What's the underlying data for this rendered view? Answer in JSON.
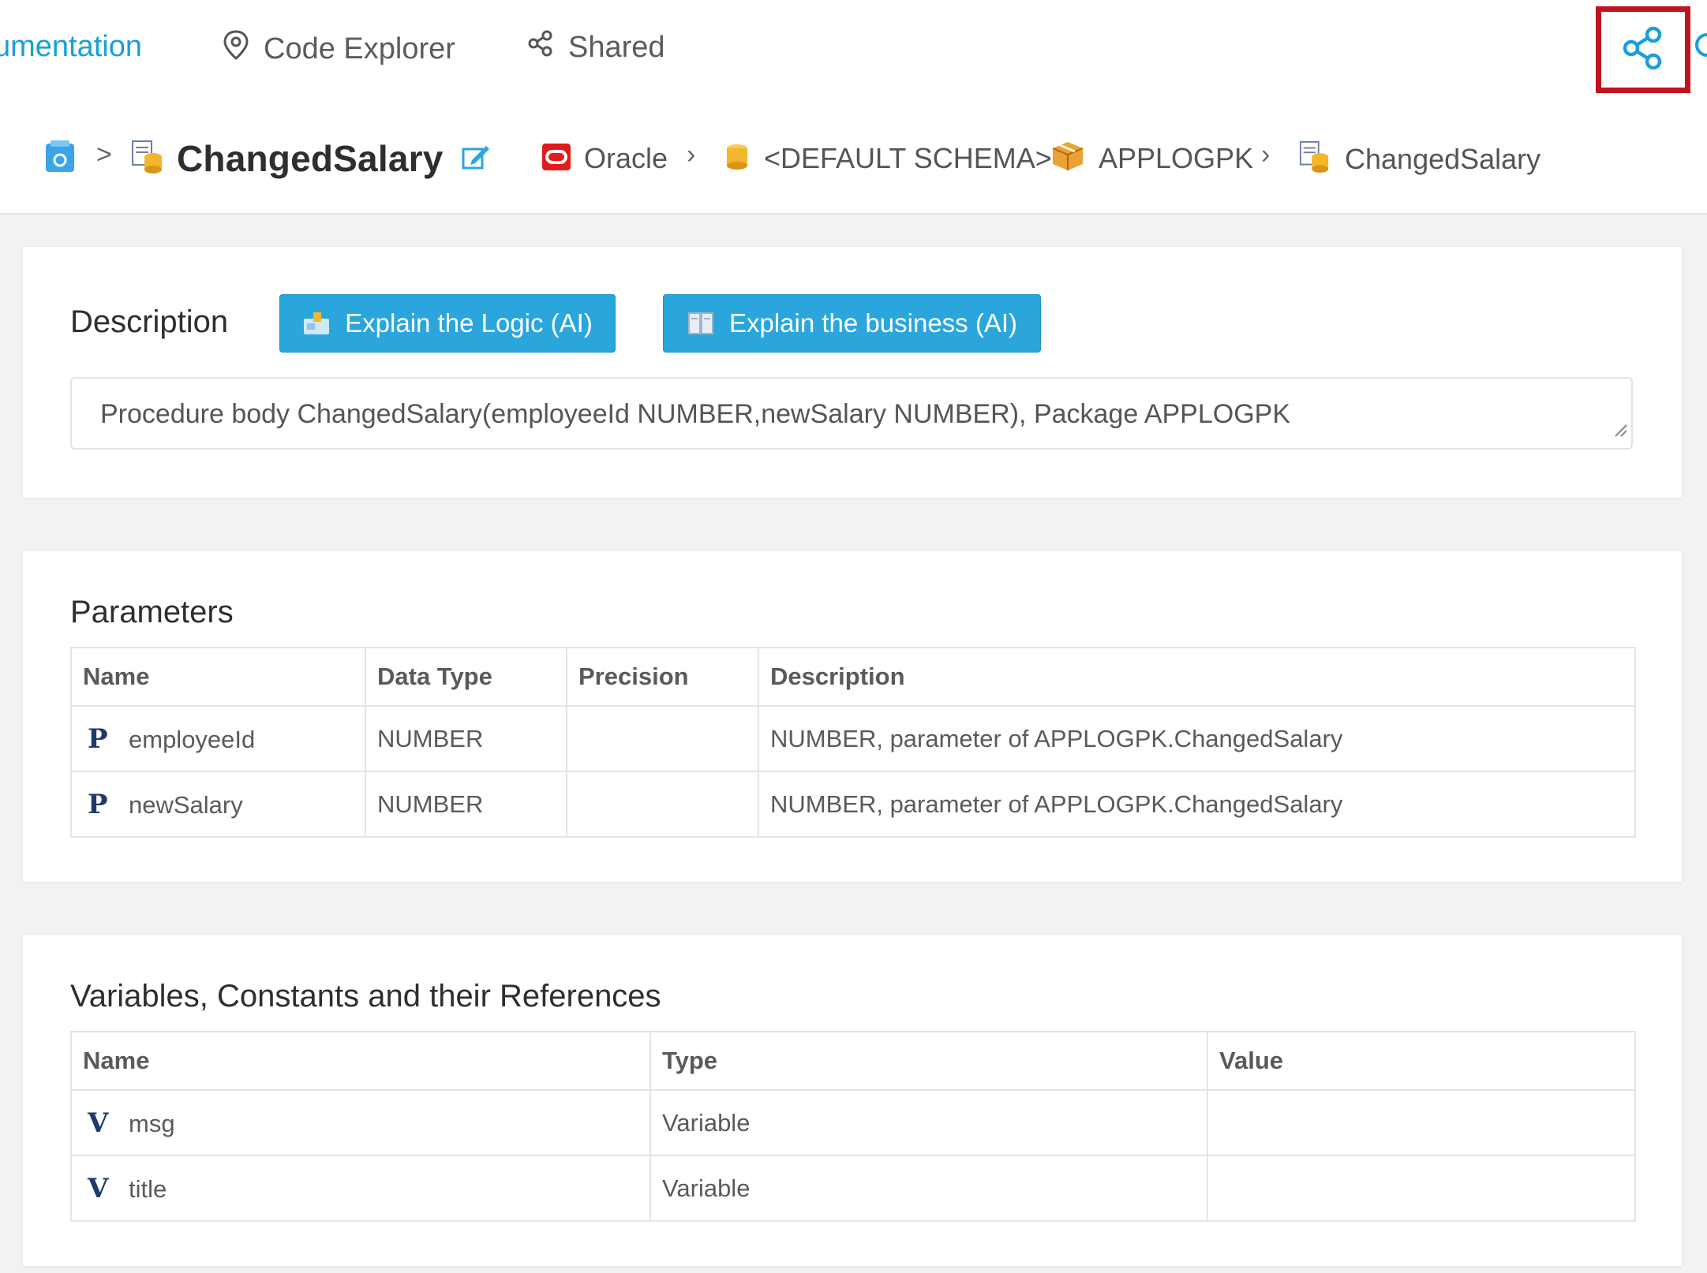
{
  "nav": {
    "items": [
      {
        "label": "umentation"
      },
      {
        "label": "Code Explorer",
        "icon": "map-marker-icon"
      },
      {
        "label": "Shared",
        "icon": "share-icon"
      }
    ],
    "share_button_icon": "share-icon",
    "accent_color": "#1a9fd9",
    "highlight_color": "#c1121f"
  },
  "header": {
    "home_icon": "home-icon",
    "title": "ChangedSalary",
    "title_icon": "procedure-icon",
    "edit_icon": "edit-icon",
    "path": [
      {
        "label": "Oracle",
        "icon": "oracle-icon"
      },
      {
        "label": "<DEFAULT SCHEMA>",
        "icon": "database-icon"
      },
      {
        "label": "APPLOGPK",
        "icon": "package-icon"
      },
      {
        "label": "ChangedSalary",
        "icon": "procedure-icon"
      }
    ]
  },
  "description": {
    "label": "Description",
    "buttons": [
      {
        "label": "Explain the Logic (AI)",
        "icon": "logic-icon"
      },
      {
        "label": "Explain the business (AI)",
        "icon": "book-icon"
      }
    ],
    "text": "Procedure body ChangedSalary(employeeId NUMBER,newSalary NUMBER), Package APPLOGPK",
    "button_color": "#2ba6dc"
  },
  "parameters": {
    "title": "Parameters",
    "columns": [
      "Name",
      "Data Type",
      "Precision",
      "Description"
    ],
    "rows": [
      {
        "kind": "P",
        "name": "employeeId",
        "type": "NUMBER",
        "precision": "",
        "description": "NUMBER, parameter of APPLOGPK.ChangedSalary"
      },
      {
        "kind": "P",
        "name": "newSalary",
        "type": "NUMBER",
        "precision": "",
        "description": "NUMBER, parameter of APPLOGPK.ChangedSalary"
      }
    ]
  },
  "variables": {
    "title": "Variables, Constants and their References",
    "columns": [
      "Name",
      "Type",
      "Value"
    ],
    "rows": [
      {
        "kind": "V",
        "name": "msg",
        "type": "Variable",
        "value": ""
      },
      {
        "kind": "V",
        "name": "title",
        "type": "Variable",
        "value": ""
      }
    ]
  }
}
